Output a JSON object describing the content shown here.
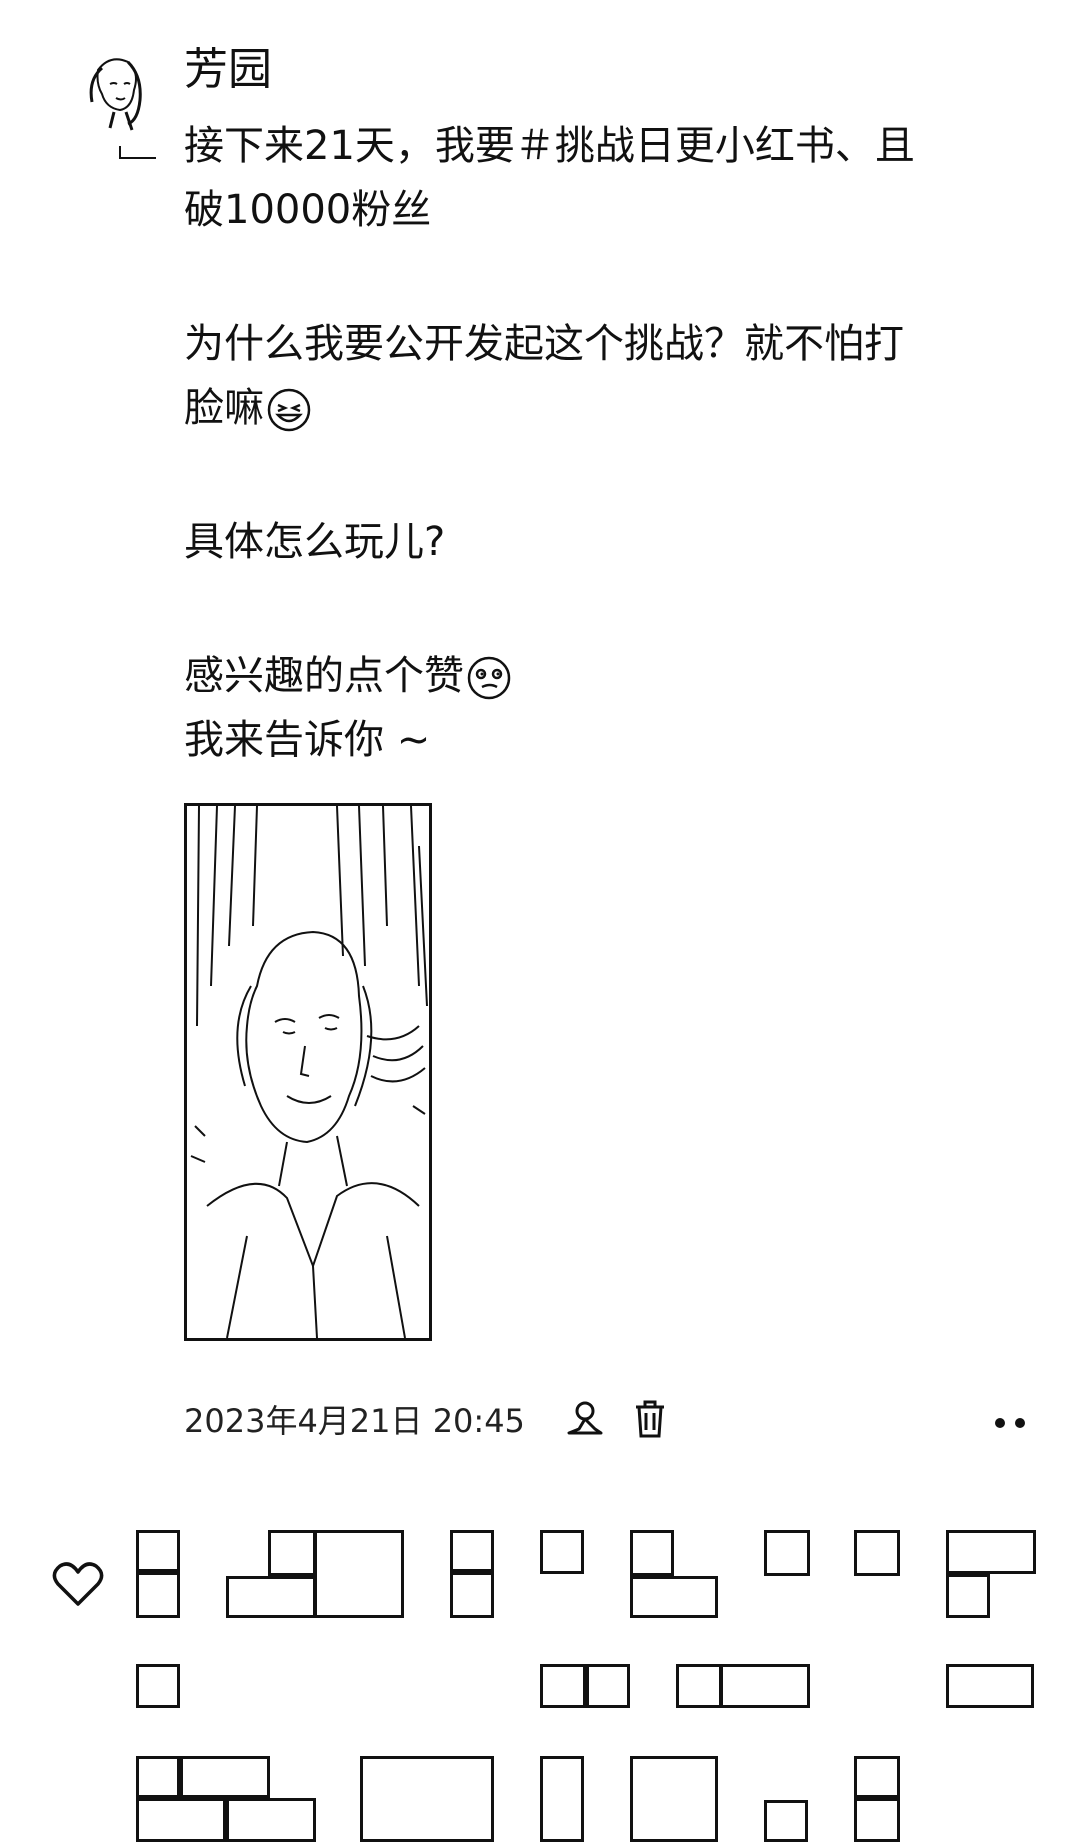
{
  "post": {
    "author": "芳园",
    "lines": [
      "接下来21天，我要＃挑战日更小红书、且",
      "破10000粉丝",
      "为什么我要公开发起这个挑战？就不怕打",
      "脸嘛",
      "具体怎么玩儿?",
      "感兴趣的点个赞",
      "我来告诉你 ~"
    ],
    "emojis": [
      "laughing-emoji",
      "smirk-emoji"
    ],
    "timestamp": "2023年4月21日 20:45"
  },
  "icons": {
    "visibility": "person-visibility-icon",
    "delete": "trash-icon",
    "more": "more-dots-icon",
    "like": "heart-outline-icon"
  }
}
